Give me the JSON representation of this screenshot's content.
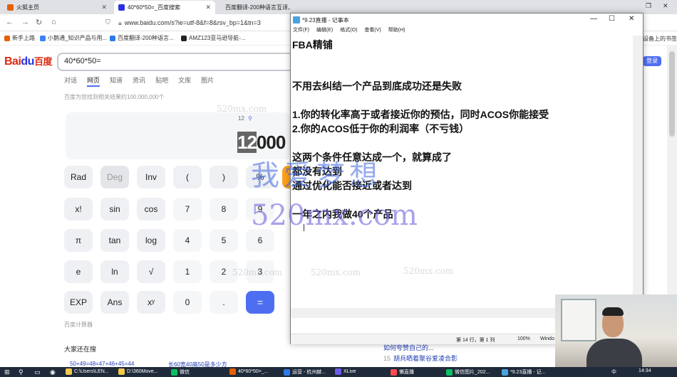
{
  "browser": {
    "tabs": [
      {
        "label": "火狐主页",
        "color": "#e66000"
      },
      {
        "label": "40*60*50=_百度搜索",
        "color": "#2932e1"
      },
      {
        "label": "百度翻译-200种语言互译、沟...",
        "color": "#2c7be5"
      }
    ],
    "url": "www.baidu.com/s?ie=utf-8&f=8&rsv_bp=1&tn=3",
    "bookmarks": [
      {
        "label": "新手上路",
        "color": "#e66000"
      },
      {
        "label": "小鹅通_知识产品与用...",
        "color": "#3b82f6"
      },
      {
        "label": "百度翻译-200种语言...",
        "color": "#2c7be5"
      },
      {
        "label": "AMZ123亚马逊导航-...",
        "color": "#222"
      }
    ],
    "bookmarks_right": "设备上的书签"
  },
  "baidu": {
    "logo_left": "Bai",
    "logo_mid": "du",
    "logo_right": "百度",
    "query": "40*60*50=",
    "tabs": [
      "对话",
      "网页",
      "知道",
      "资讯",
      "贴吧",
      "文库",
      "图片"
    ],
    "result_count": "百度为您找到相关结果约100,000,000个",
    "login": "登录",
    "calc": {
      "expression": "12",
      "result_highlight": "12",
      "result_rest": "000",
      "label": "百度计算器",
      "keys": [
        [
          "Rad",
          "Deg",
          "Inv",
          "(",
          ")",
          "%"
        ],
        [
          "x!",
          "sin",
          "cos",
          "7",
          "8",
          "9"
        ],
        [
          "π",
          "tan",
          "log",
          "4",
          "5",
          "6"
        ],
        [
          "e",
          "ln",
          "√",
          "1",
          "2",
          "3"
        ],
        [
          "EXP",
          "Ans",
          "xʸ",
          "0",
          ".",
          "="
        ]
      ]
    },
    "also_search_title": "大家还在搜",
    "also_search_left": "50+49=48=47+46+45=44",
    "also_search_mid": "长60宽40高50是多少方",
    "related_1": "如何夸赞自己的...",
    "related_2_num": "15",
    "related_2_text": "胡兵晒着聚谷爱凌合影"
  },
  "notepad": {
    "title": "*9.23直播 - 记事本",
    "menu": [
      "文件(F)",
      "编辑(E)",
      "格式(O)",
      "查看(V)",
      "帮助(H)"
    ],
    "lines": [
      "FBA精铺",
      "",
      "不用去纠结一个产品到底成功还是失败",
      "",
      "1.你的转化率高于或者接近你的预估，同时ACOS你能接受",
      "2.你的ACOS低于你的利润率（不亏钱）",
      "",
      "这两个条件任意达成一个，就算成了",
      "都没有达到",
      "通过优化能否接近或者达到",
      "",
      "一年之内我做40个产品"
    ],
    "status_pos": "第 14 行，第 1 列",
    "status_zoom": "100%",
    "status_eol": "Windo"
  },
  "watermark": {
    "big": "我爱梦想",
    "url": "520mx.com",
    "small": "520mx.com"
  },
  "taskbar": {
    "items": [
      {
        "label": "C:\\Users\\LEN...",
        "color": "#f2c94c"
      },
      {
        "label": "D:\\360Move...",
        "color": "#f2c94c"
      },
      {
        "label": "微信",
        "color": "#07c160"
      },
      {
        "label": "40*60*50=_...",
        "color": "#e66000"
      },
      {
        "label": "运营 - 杭州赫...",
        "color": "#2c7be5"
      },
      {
        "label": "XLive",
        "color": "#6c5ce7"
      },
      {
        "label": "懒直播",
        "color": "#ff4d4f"
      },
      {
        "label": "微信图片_202...",
        "color": "#07c160"
      },
      {
        "label": "*9.23直播 - 记...",
        "color": "#4aa3df"
      }
    ],
    "ime": "中",
    "time": "14:34"
  }
}
